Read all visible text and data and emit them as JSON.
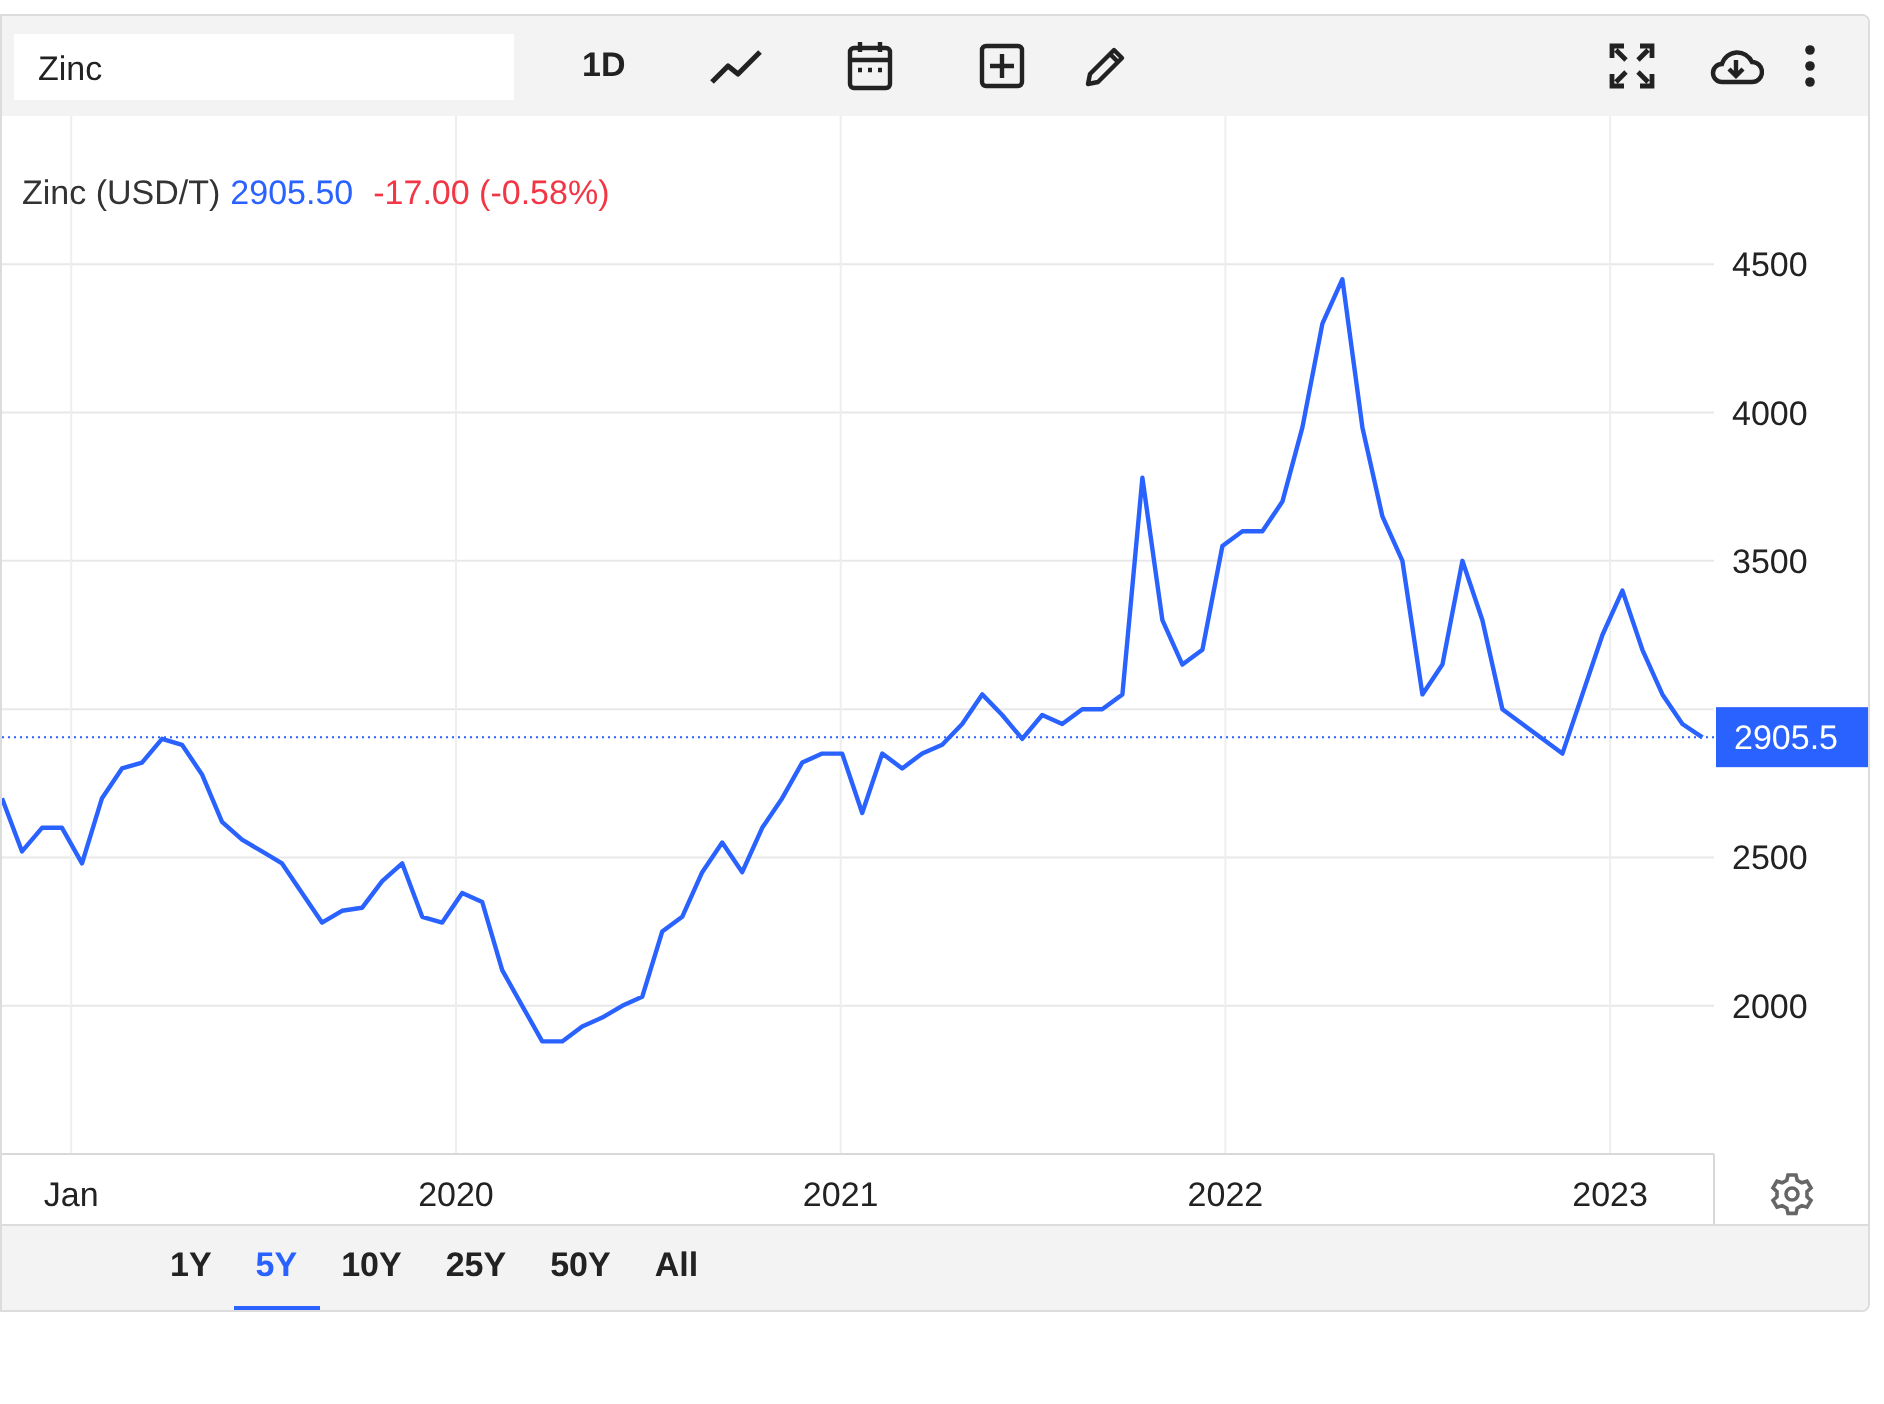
{
  "toolbar": {
    "search": {
      "value": "Zinc"
    },
    "interval": "1D"
  },
  "quote": {
    "name": "Zinc (USD/T)",
    "price": "2905.50",
    "change": "-17.00 (-0.58%)"
  },
  "chart_data": {
    "type": "line",
    "xlim": [
      2018.82,
      2023.27
    ],
    "ylim": [
      1500,
      5000
    ],
    "xticks": [
      {
        "value": 2019,
        "label": "Jan"
      },
      {
        "value": 2020,
        "label": "2020"
      },
      {
        "value": 2021,
        "label": "2021"
      },
      {
        "value": 2022,
        "label": "2022"
      },
      {
        "value": 2023,
        "label": "2023"
      }
    ],
    "yticks": [
      2000,
      2500,
      3500,
      4000,
      4500
    ],
    "x": [
      2018.82,
      2018.872,
      2018.924,
      2018.976,
      2019.028,
      2019.08,
      2019.132,
      2019.184,
      2019.236,
      2019.288,
      2019.34,
      2019.392,
      2019.444,
      2019.496,
      2019.548,
      2019.6,
      2019.652,
      2019.704,
      2019.756,
      2019.808,
      2019.86,
      2019.912,
      2019.964,
      2020.016,
      2020.068,
      2020.12,
      2020.172,
      2020.224,
      2020.276,
      2020.328,
      2020.38,
      2020.432,
      2020.484,
      2020.536,
      2020.588,
      2020.64,
      2020.692,
      2020.744,
      2020.796,
      2020.848,
      2020.9,
      2020.952,
      2021.004,
      2021.056,
      2021.108,
      2021.16,
      2021.212,
      2021.264,
      2021.316,
      2021.368,
      2021.42,
      2021.472,
      2021.524,
      2021.576,
      2021.628,
      2021.68,
      2021.732,
      2021.784,
      2021.836,
      2021.888,
      2021.94,
      2021.992,
      2022.044,
      2022.096,
      2022.148,
      2022.2,
      2022.252,
      2022.304,
      2022.356,
      2022.408,
      2022.46,
      2022.512,
      2022.564,
      2022.616,
      2022.668,
      2022.72,
      2022.772,
      2022.824,
      2022.876,
      2022.928,
      2022.98,
      2023.032,
      2023.084,
      2023.136,
      2023.188,
      2023.24
    ],
    "grid": true,
    "series": [
      {
        "color": "#2962ff",
        "values": [
          2700,
          2520,
          2600,
          2600,
          2480,
          2700,
          2800,
          2820,
          2900,
          2880,
          2780,
          2620,
          2560,
          2520,
          2480,
          2380,
          2280,
          2320,
          2330,
          2420,
          2480,
          2300,
          2280,
          2380,
          2350,
          2120,
          2000,
          1880,
          1880,
          1930,
          1960,
          2000,
          2030,
          2250,
          2300,
          2450,
          2550,
          2450,
          2600,
          2700,
          2820,
          2850,
          2850,
          2650,
          2850,
          2800,
          2850,
          2880,
          2950,
          3050,
          2980,
          2900,
          2980,
          2950,
          3000,
          3000,
          3050,
          3780,
          3300,
          3150,
          3200,
          3550,
          3600,
          3600,
          3700,
          3950,
          4300,
          4450,
          3950,
          3650,
          3500,
          3050,
          3150,
          3500,
          3300,
          3000,
          2950,
          2900,
          2850,
          3050,
          3250,
          3400,
          3200,
          3050,
          2950,
          2905
        ]
      }
    ],
    "ref_lines": [
      {
        "axis": "y",
        "value": 2905.5,
        "label": "2905.5",
        "color": "#2962ff"
      }
    ]
  },
  "ranges": [
    {
      "label": "1Y",
      "selected": false
    },
    {
      "label": "5Y",
      "selected": true
    },
    {
      "label": "10Y",
      "selected": false
    },
    {
      "label": "25Y",
      "selected": false
    },
    {
      "label": "50Y",
      "selected": false
    },
    {
      "label": "All",
      "selected": false
    }
  ]
}
